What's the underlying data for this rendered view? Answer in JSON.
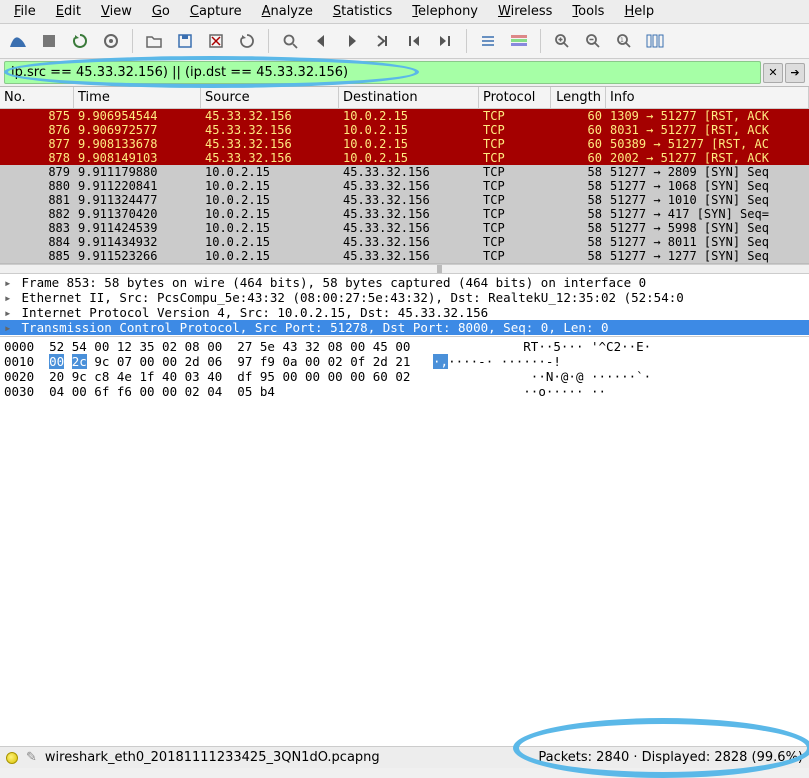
{
  "menu": {
    "items": [
      {
        "ul": "F",
        "rest": "ile"
      },
      {
        "ul": "E",
        "rest": "dit"
      },
      {
        "ul": "V",
        "rest": "iew"
      },
      {
        "ul": "G",
        "rest": "o"
      },
      {
        "ul": "C",
        "rest": "apture"
      },
      {
        "ul": "A",
        "rest": "nalyze"
      },
      {
        "ul": "S",
        "rest": "tatistics"
      },
      {
        "ul": "T",
        "rest": "elephony"
      },
      {
        "ul": "W",
        "rest": "ireless"
      },
      {
        "ul": "T",
        "rest": "ools"
      },
      {
        "ul": "H",
        "rest": "elp"
      }
    ]
  },
  "filter": {
    "value": "ip.src == 45.33.32.156) || (ip.dst == 45.33.32.156)"
  },
  "columns": {
    "no": "No.",
    "time": "Time",
    "source": "Source",
    "destination": "Destination",
    "protocol": "Protocol",
    "length": "Length",
    "info": "Info"
  },
  "packets": [
    {
      "no": "875",
      "time": "9.906954544",
      "src": "45.33.32.156",
      "dst": "10.0.2.15",
      "proto": "TCP",
      "len": "60",
      "info": "1309 → 51277 [RST, ACK",
      "cls": "red"
    },
    {
      "no": "876",
      "time": "9.906972577",
      "src": "45.33.32.156",
      "dst": "10.0.2.15",
      "proto": "TCP",
      "len": "60",
      "info": "8031 → 51277 [RST, ACK",
      "cls": "red"
    },
    {
      "no": "877",
      "time": "9.908133678",
      "src": "45.33.32.156",
      "dst": "10.0.2.15",
      "proto": "TCP",
      "len": "60",
      "info": "50389 → 51277 [RST, AC",
      "cls": "red"
    },
    {
      "no": "878",
      "time": "9.908149103",
      "src": "45.33.32.156",
      "dst": "10.0.2.15",
      "proto": "TCP",
      "len": "60",
      "info": "2002 → 51277 [RST, ACK",
      "cls": "red"
    },
    {
      "no": "879",
      "time": "9.911179880",
      "src": "10.0.2.15",
      "dst": "45.33.32.156",
      "proto": "TCP",
      "len": "58",
      "info": "51277 → 2809 [SYN] Seq",
      "cls": "gray"
    },
    {
      "no": "880",
      "time": "9.911220841",
      "src": "10.0.2.15",
      "dst": "45.33.32.156",
      "proto": "TCP",
      "len": "58",
      "info": "51277 → 1068 [SYN] Seq",
      "cls": "gray"
    },
    {
      "no": "881",
      "time": "9.911324477",
      "src": "10.0.2.15",
      "dst": "45.33.32.156",
      "proto": "TCP",
      "len": "58",
      "info": "51277 → 1010 [SYN] Seq",
      "cls": "gray"
    },
    {
      "no": "882",
      "time": "9.911370420",
      "src": "10.0.2.15",
      "dst": "45.33.32.156",
      "proto": "TCP",
      "len": "58",
      "info": "51277 → 417 [SYN] Seq=",
      "cls": "gray"
    },
    {
      "no": "883",
      "time": "9.911424539",
      "src": "10.0.2.15",
      "dst": "45.33.32.156",
      "proto": "TCP",
      "len": "58",
      "info": "51277 → 5998 [SYN] Seq",
      "cls": "gray"
    },
    {
      "no": "884",
      "time": "9.911434932",
      "src": "10.0.2.15",
      "dst": "45.33.32.156",
      "proto": "TCP",
      "len": "58",
      "info": "51277 → 8011 [SYN] Seq",
      "cls": "gray"
    },
    {
      "no": "885",
      "time": "9.911523266",
      "src": "10.0.2.15",
      "dst": "45.33.32.156",
      "proto": "TCP",
      "len": "58",
      "info": "51277 → 1277 [SYN] Seq",
      "cls": "gray"
    }
  ],
  "details": [
    {
      "exp": "r",
      "text": "Frame 853: 58 bytes on wire (464 bits), 58 bytes captured (464 bits) on interface 0",
      "sel": false
    },
    {
      "exp": "r",
      "text": "Ethernet II, Src: PcsCompu_5e:43:32 (08:00:27:5e:43:32), Dst: RealtekU_12:35:02 (52:54:0",
      "sel": false
    },
    {
      "exp": "r",
      "text": "Internet Protocol Version 4, Src: 10.0.2.15, Dst: 45.33.32.156",
      "sel": false
    },
    {
      "exp": "r",
      "text": "Transmission Control Protocol, Src Port: 51278, Dst Port: 8000, Seq: 0, Len: 0",
      "sel": true
    }
  ],
  "hex": {
    "lines": [
      {
        "off": "0000",
        "hex": "52 54 00 12 35 02 08 00  27 5e 43 32 08 00 45 00",
        "asc": "RT··5··· '^C2··E·"
      },
      {
        "off": "0010",
        "hex": "00 2c 9c 07 00 00 2d 06  97 f9 0a 00 02 0f 2d 21",
        "asc": "·,····-· ······-!"
      },
      {
        "off": "0020",
        "hex": "20 9c c8 4e 1f 40 03 40  df 95 00 00 00 00 60 02",
        "asc": " ··N·@·@ ······`·"
      },
      {
        "off": "0030",
        "hex": "04 00 6f f6 00 00 02 04  05 b4",
        "asc": "··o····· ··"
      }
    ],
    "highlight_row": 1,
    "highlight_cols": [
      0,
      1
    ]
  },
  "status": {
    "filename": "wireshark_eth0_20181111233425_3QN1dO.pcapng",
    "stats": "Packets: 2840 · Displayed: 2828 (99.6%)"
  }
}
